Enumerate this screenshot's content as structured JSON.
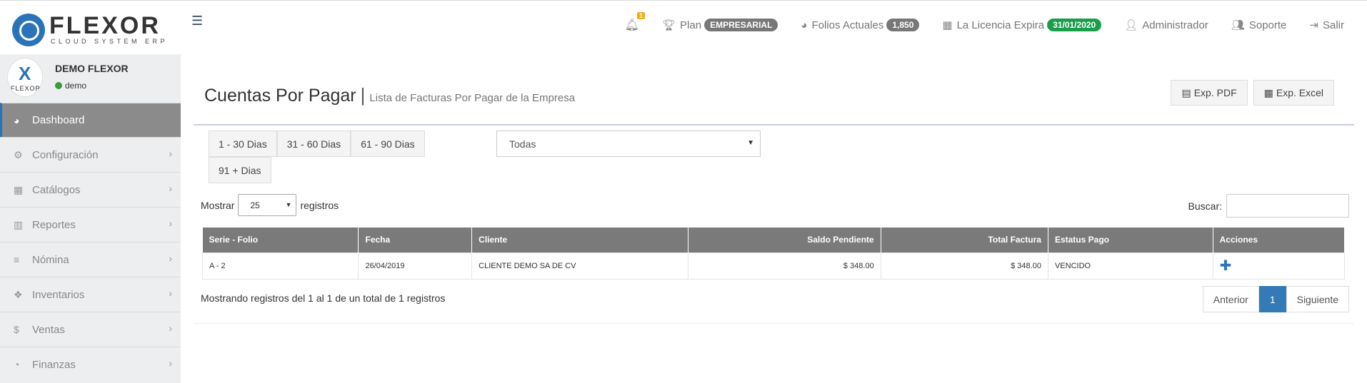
{
  "brand": {
    "name": "FLEXOR",
    "tagline": "CLOUD SYSTEM ERP",
    "trademark": "®"
  },
  "topnav": {
    "notifications_count": "1",
    "plan_label": "Plan",
    "plan_badge": "EMPRESARIAL",
    "folios_label": "Folios Actuales",
    "folios_badge": "1,850",
    "license_label": "La Licencia Expira",
    "license_badge": "31/01/2020",
    "admin_label": "Administrador",
    "support_label": "Soporte",
    "logout_label": "Salir"
  },
  "profile": {
    "name": "DEMO FLEXOR",
    "status": "demo",
    "avatar_text": "FLEXOR"
  },
  "sidebar": {
    "items": [
      {
        "label": "Dashboard",
        "icon": "dashboard-icon"
      },
      {
        "label": "Configuración",
        "icon": "gears-icon"
      },
      {
        "label": "Catálogos",
        "icon": "grid-icon"
      },
      {
        "label": "Reportes",
        "icon": "bar-chart-icon"
      },
      {
        "label": "Nómina",
        "icon": "database-icon"
      },
      {
        "label": "Inventarios",
        "icon": "dropbox-icon"
      },
      {
        "label": "Ventas",
        "icon": "dollar-icon"
      },
      {
        "label": "Finanzas",
        "icon": "pie-chart-icon"
      }
    ]
  },
  "header": {
    "title": "Cuentas Por Pagar",
    "subtitle": "Lista de Facturas Por Pagar de la Empresa",
    "pdf_label": "Exp. PDF",
    "excel_label": "Exp. Excel"
  },
  "filters": {
    "ranges": [
      "1 - 30 Dias",
      "31 - 60 Dias",
      "61 - 90 Dias",
      "91 + Dias"
    ],
    "status_selected": "Todas"
  },
  "table_controls": {
    "show_label": "Mostrar",
    "page_length": "25",
    "records_label": "registros",
    "search_label": "Buscar:"
  },
  "table": {
    "headers": [
      "Serie - Folio",
      "Fecha",
      "Cliente",
      "Saldo Pendiente",
      "Total Factura",
      "Estatus Pago",
      "Acciones"
    ],
    "rows": [
      {
        "serie": "A - 2",
        "fecha": "26/04/2019",
        "cliente": "CLIENTE DEMO SA DE CV",
        "saldo": "$ 348.00",
        "total": "$ 348.00",
        "estatus": "VENCIDO"
      }
    ]
  },
  "footer": {
    "info": "Mostrando registros del 1 al 1 de un total de 1 registros",
    "prev": "Anterior",
    "page": "1",
    "next": "Siguiente"
  }
}
